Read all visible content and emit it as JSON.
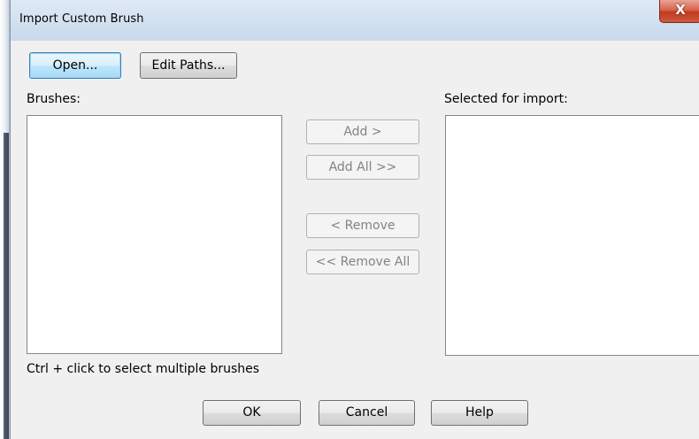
{
  "window": {
    "title": "Import Custom Brush",
    "close_symbol": "X"
  },
  "toolbar": {
    "open_label": "Open...",
    "edit_paths_label": "Edit Paths..."
  },
  "brushes": {
    "label": "Brushes:",
    "hint": "Ctrl + click to select multiple brushes"
  },
  "selected": {
    "label": "Selected for import:"
  },
  "transfer": {
    "add_label": "Add >",
    "add_all_label": "Add All >>",
    "remove_label": "< Remove",
    "remove_all_label": "<< Remove All"
  },
  "footer": {
    "ok_label": "OK",
    "cancel_label": "Cancel",
    "help_label": "Help"
  },
  "colors": {
    "default_button_border": "#3c7fb1",
    "close_button": "#c23a20",
    "disabled_text": "#838383"
  }
}
